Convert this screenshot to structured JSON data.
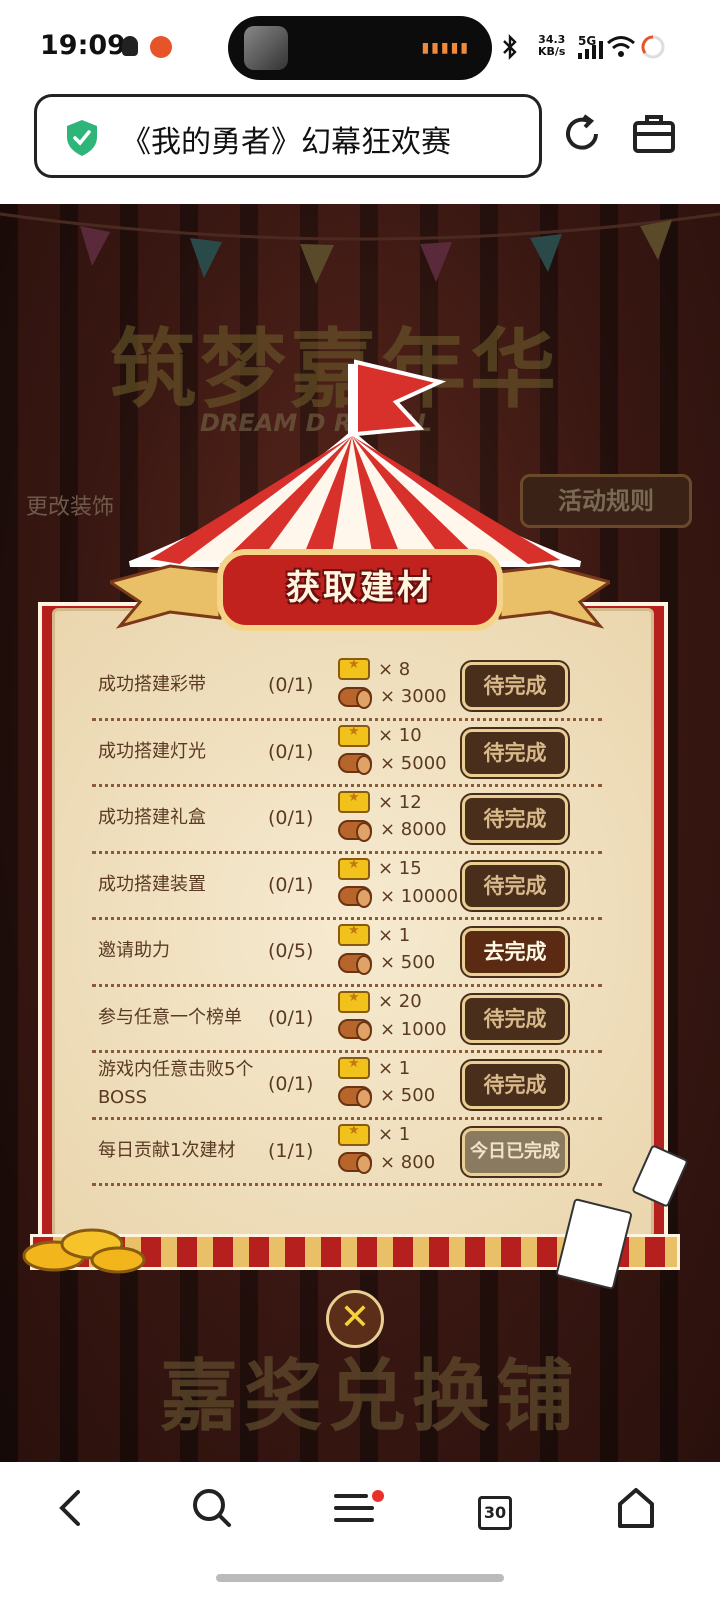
{
  "status_bar": {
    "time": "19:09",
    "net_speed": "34.3",
    "net_unit": "KB/s",
    "network": "5G"
  },
  "browser": {
    "title": "《我的勇者》幻幕狂欢赛"
  },
  "game": {
    "bg_title": "筑梦嘉年华",
    "bg_subtitle": "DREAM D    RNIVAL",
    "change_decor": "更改装饰",
    "rules": "活动规则",
    "shop": "嘉奖兑换铺"
  },
  "modal": {
    "title": "获取建材",
    "tasks": [
      {
        "name": "成功搭建彩带",
        "progress": "(0/1)",
        "ticket": "× 8",
        "wood": "× 3000",
        "action": "待完成"
      },
      {
        "name": "成功搭建灯光",
        "progress": "(0/1)",
        "ticket": "× 10",
        "wood": "× 5000",
        "action": "待完成"
      },
      {
        "name": "成功搭建礼盒",
        "progress": "(0/1)",
        "ticket": "× 12",
        "wood": "× 8000",
        "action": "待完成"
      },
      {
        "name": "成功搭建装置",
        "progress": "(0/1)",
        "ticket": "× 15",
        "wood": "× 10000",
        "action": "待完成"
      },
      {
        "name": "邀请助力",
        "progress": "(0/5)",
        "ticket": "× 1",
        "wood": "× 500",
        "action": "去完成"
      },
      {
        "name": "参与任意一个榜单",
        "progress": "(0/1)",
        "ticket": "× 20",
        "wood": "× 1000",
        "action": "待完成"
      },
      {
        "name": "游戏内任意击败5个BOSS",
        "progress": "(0/1)",
        "ticket": "× 1",
        "wood": "× 500",
        "action": "待完成"
      },
      {
        "name": "每日贡献1次建材",
        "progress": "(1/1)",
        "ticket": "× 1",
        "wood": "× 800",
        "action": "今日已完成"
      }
    ],
    "close": "✕"
  },
  "nav": {
    "tabs_count": "30"
  }
}
